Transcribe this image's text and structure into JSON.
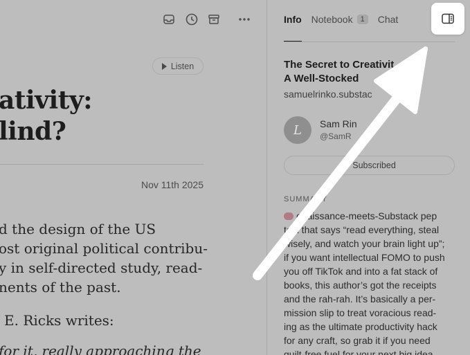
{
  "article": {
    "toolbar": {
      "inbox_icon": "inbox-icon",
      "history_icon": "clock-icon",
      "archive_icon": "archive-icon",
      "more_icon": "ellipsis-icon"
    },
    "listen_label": "Listen",
    "headline": "ativity:\nlind?",
    "date": "Nov 11th 2025",
    "body": "d the design of the US\nost original political contribu-\ny in self-directed study, read-\nnents of the past.",
    "writer_line": "E. Ricks writes:",
    "quote_line": "for it, really approaching the"
  },
  "sidebar": {
    "tabs": [
      {
        "label": "Info",
        "active": true
      },
      {
        "label": "Notebook",
        "badge": "1"
      },
      {
        "label": "Chat"
      }
    ],
    "toggle_icon": "sidebar-toggle-icon",
    "title": "The Secret to Creativit\nA Well-Stocked",
    "domain": "samuelrinko.substac",
    "author_name": "Sam Rin",
    "author_handle": "@SamR",
    "avatar_letter": "L",
    "subscribe_label": "Subscribed",
    "summary_label": "SUMMARY",
    "summary": "enaissance-meets-Substack pep\ntalk that says “read everything, steal\nwisely, and watch your brain light up”;\nif you want intellectual FOMO to push\nyou off TikTok and into a fat stack of\nbooks, this author’s got the receipts\nand the rah-rah. It’s basically a per-\nmission slip to treat voracious read-\ning as the ultimate productivity hack\nfor any craft, so grab it if you need\nguilt-free fuel for your next big idea"
  },
  "colors": {
    "overlay_background": "#bdbdbd",
    "arrow": "#ffffff"
  }
}
